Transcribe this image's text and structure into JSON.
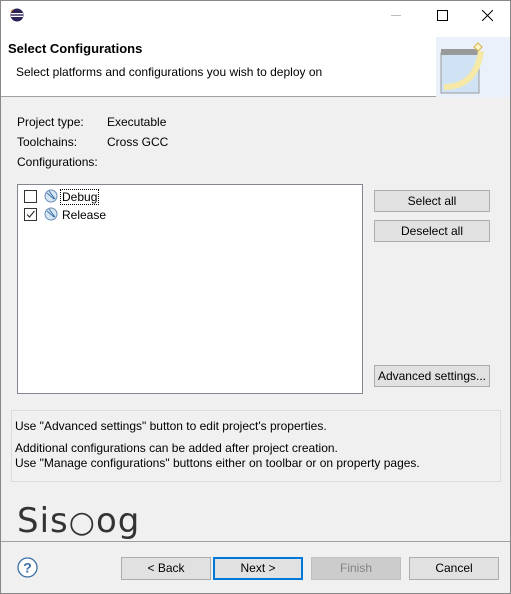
{
  "window": {
    "icon": "eclipse-icon",
    "controls": [
      "minimize",
      "maximize",
      "close"
    ]
  },
  "header": {
    "title": "Select Configurations",
    "subtitle": "Select platforms and configurations you wish to deploy on",
    "banner_icon": "wizard-banner-icon"
  },
  "project": {
    "type_label": "Project type:",
    "type_value": "Executable",
    "toolchains_label": "Toolchains:",
    "toolchains_value": "Cross GCC",
    "configurations_label": "Configurations:"
  },
  "configurations": [
    {
      "name": "Debug",
      "checked": false,
      "focused": true
    },
    {
      "name": "Release",
      "checked": true
    }
  ],
  "side_buttons": {
    "select_all": "Select all",
    "deselect_all": "Deselect all",
    "advanced": "Advanced settings..."
  },
  "info": {
    "line1": "Use \"Advanced settings\" button to edit project's properties.",
    "line2": "Additional configurations can be added after project creation.",
    "line3": "Use \"Manage configurations\" buttons either on toolbar or on property pages."
  },
  "watermark": "Sis○og",
  "footer": {
    "back": "< Back",
    "next": "Next >",
    "finish": "Finish",
    "cancel": "Cancel",
    "finish_enabled": false,
    "help_icon": "help-icon"
  },
  "colors": {
    "accent": "#0078d7"
  }
}
